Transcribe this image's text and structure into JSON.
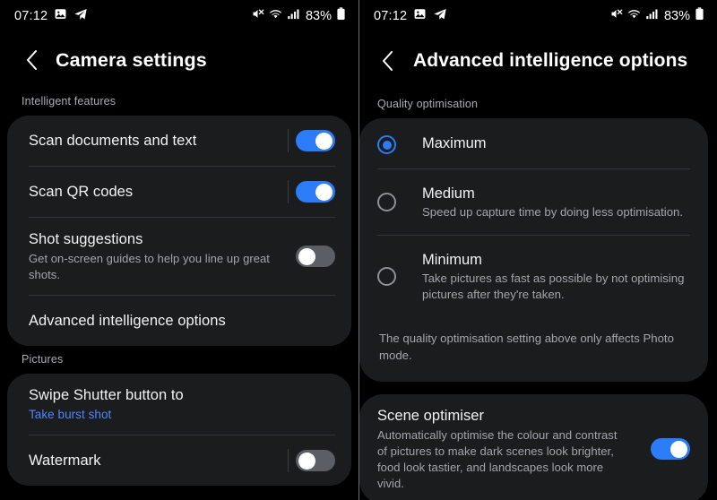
{
  "status_bar": {
    "time": "07:12",
    "battery_percent": "83%",
    "icons": [
      "gallery-icon",
      "telegram-icon",
      "mute-icon",
      "wifi-icon",
      "signal-icon",
      "battery-icon"
    ]
  },
  "left_panel": {
    "title": "Camera settings",
    "back_label": "Back",
    "sections": [
      {
        "label": "Intelligent features",
        "rows": [
          {
            "title": "Scan documents and text",
            "sub": "",
            "control": "toggle",
            "state": "on"
          },
          {
            "title": "Scan QR codes",
            "sub": "",
            "control": "toggle",
            "state": "on"
          },
          {
            "title": "Shot suggestions",
            "sub": "Get on-screen guides to help you line up great shots.",
            "control": "toggle",
            "state": "off"
          },
          {
            "title": "Advanced intelligence options",
            "sub": "",
            "control": "none",
            "state": ""
          }
        ]
      },
      {
        "label": "Pictures",
        "rows": [
          {
            "title": "Swipe Shutter button to",
            "sub": "Take burst shot",
            "control": "none",
            "state": ""
          },
          {
            "title": "Watermark",
            "sub": "",
            "control": "toggle",
            "state": "off"
          }
        ]
      }
    ]
  },
  "right_panel": {
    "title": "Advanced intelligence options",
    "back_label": "Back",
    "section_label": "Quality optimisation",
    "options": [
      {
        "title": "Maximum",
        "sub": "",
        "selected": true
      },
      {
        "title": "Medium",
        "sub": "Speed up capture time by doing less optimisation.",
        "selected": false
      },
      {
        "title": "Minimum",
        "sub": "Take pictures as fast as possible by not optimising pictures after they're taken.",
        "selected": false
      }
    ],
    "note": "The quality optimisation setting above only affects Photo mode.",
    "scene": {
      "title": "Scene optimiser",
      "sub": "Automatically optimise the colour and contrast of pictures to make dark scenes look brighter, food look tastier, and landscapes look more vivid.",
      "state": "on"
    }
  },
  "colors": {
    "accent": "#2b7cf6",
    "link": "#4e87ff",
    "card": "#1b1c1e",
    "background": "#000000"
  }
}
